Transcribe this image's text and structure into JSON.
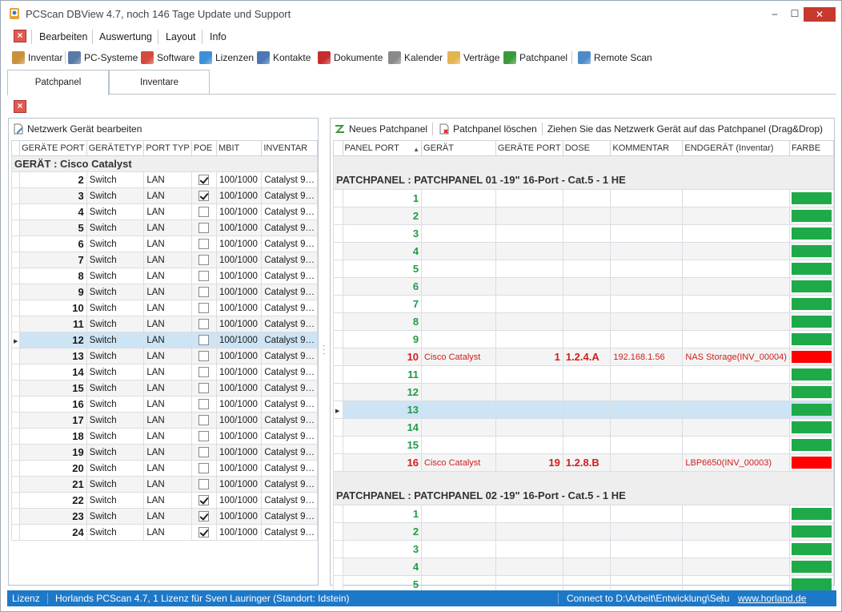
{
  "window": {
    "title": "PCScan DBView 4.7, noch 146 Tage Update und Support",
    "min_glyph": "–",
    "max_glyph": "☐",
    "close_glyph": "✕"
  },
  "menu": [
    {
      "label": "Bearbeiten"
    },
    {
      "label": "Auswertung"
    },
    {
      "label": "Layout"
    },
    {
      "label": "Info"
    }
  ],
  "toolbar": [
    {
      "label": "Inventar",
      "icon": "inventory-icon",
      "color": "#c8913a"
    },
    {
      "label": "PC-Systeme",
      "icon": "computer-icon",
      "color": "#5a7aa6"
    },
    {
      "label": "Software",
      "icon": "software-icon",
      "color": "#d64a3b"
    },
    {
      "label": "Lizenzen",
      "icon": "windows-icon",
      "color": "#3c8fd8"
    },
    {
      "label": "Kontakte",
      "icon": "contacts-icon",
      "color": "#4c77b5"
    },
    {
      "label": "Dokumente",
      "icon": "pdf-icon",
      "color": "#c62e2e"
    },
    {
      "label": "Kalender",
      "icon": "calendar-icon",
      "color": "#8a8a8a"
    },
    {
      "label": "Verträge",
      "icon": "contract-icon",
      "color": "#e2b54e"
    },
    {
      "label": "Patchpanel",
      "icon": "patchpanel-icon",
      "color": "#3a9a3a"
    },
    {
      "label": "Remote Scan",
      "icon": "remote-scan-icon",
      "color": "#4d8ac8"
    }
  ],
  "tabs": [
    {
      "label": "Patchpanel",
      "active": true
    },
    {
      "label": "Inventare",
      "active": false
    }
  ],
  "left": {
    "toolbar_label": "Netzwerk Gerät bearbeiten",
    "columns": [
      "GERÄTE PORT",
      "GERÄTETYP",
      "PORT TYP",
      "POE",
      "MBIT",
      "INVENTAR"
    ],
    "group_label": "GERÄT : Cisco Catalyst",
    "rows": [
      {
        "port": "2",
        "type": "Switch",
        "port_type": "LAN",
        "poe": true,
        "mbit": "100/1000",
        "inventar": "Catalyst 9…"
      },
      {
        "port": "3",
        "type": "Switch",
        "port_type": "LAN",
        "poe": true,
        "mbit": "100/1000",
        "inventar": "Catalyst 9…"
      },
      {
        "port": "4",
        "type": "Switch",
        "port_type": "LAN",
        "poe": false,
        "mbit": "100/1000",
        "inventar": "Catalyst 9…"
      },
      {
        "port": "5",
        "type": "Switch",
        "port_type": "LAN",
        "poe": false,
        "mbit": "100/1000",
        "inventar": "Catalyst 9…"
      },
      {
        "port": "6",
        "type": "Switch",
        "port_type": "LAN",
        "poe": false,
        "mbit": "100/1000",
        "inventar": "Catalyst 9…"
      },
      {
        "port": "7",
        "type": "Switch",
        "port_type": "LAN",
        "poe": false,
        "mbit": "100/1000",
        "inventar": "Catalyst 9…"
      },
      {
        "port": "8",
        "type": "Switch",
        "port_type": "LAN",
        "poe": false,
        "mbit": "100/1000",
        "inventar": "Catalyst 9…"
      },
      {
        "port": "9",
        "type": "Switch",
        "port_type": "LAN",
        "poe": false,
        "mbit": "100/1000",
        "inventar": "Catalyst 9…"
      },
      {
        "port": "10",
        "type": "Switch",
        "port_type": "LAN",
        "poe": false,
        "mbit": "100/1000",
        "inventar": "Catalyst 9…"
      },
      {
        "port": "11",
        "type": "Switch",
        "port_type": "LAN",
        "poe": false,
        "mbit": "100/1000",
        "inventar": "Catalyst 9…"
      },
      {
        "port": "12",
        "type": "Switch",
        "port_type": "LAN",
        "poe": false,
        "mbit": "100/1000",
        "inventar": "Catalyst 9…",
        "selected": true
      },
      {
        "port": "13",
        "type": "Switch",
        "port_type": "LAN",
        "poe": false,
        "mbit": "100/1000",
        "inventar": "Catalyst 9…"
      },
      {
        "port": "14",
        "type": "Switch",
        "port_type": "LAN",
        "poe": false,
        "mbit": "100/1000",
        "inventar": "Catalyst 9…"
      },
      {
        "port": "15",
        "type": "Switch",
        "port_type": "LAN",
        "poe": false,
        "mbit": "100/1000",
        "inventar": "Catalyst 9…"
      },
      {
        "port": "16",
        "type": "Switch",
        "port_type": "LAN",
        "poe": false,
        "mbit": "100/1000",
        "inventar": "Catalyst 9…"
      },
      {
        "port": "17",
        "type": "Switch",
        "port_type": "LAN",
        "poe": false,
        "mbit": "100/1000",
        "inventar": "Catalyst 9…"
      },
      {
        "port": "18",
        "type": "Switch",
        "port_type": "LAN",
        "poe": false,
        "mbit": "100/1000",
        "inventar": "Catalyst 9…"
      },
      {
        "port": "19",
        "type": "Switch",
        "port_type": "LAN",
        "poe": false,
        "mbit": "100/1000",
        "inventar": "Catalyst 9…"
      },
      {
        "port": "20",
        "type": "Switch",
        "port_type": "LAN",
        "poe": false,
        "mbit": "100/1000",
        "inventar": "Catalyst 9…"
      },
      {
        "port": "21",
        "type": "Switch",
        "port_type": "LAN",
        "poe": false,
        "mbit": "100/1000",
        "inventar": "Catalyst 9…"
      },
      {
        "port": "22",
        "type": "Switch",
        "port_type": "LAN",
        "poe": true,
        "mbit": "100/1000",
        "inventar": "Catalyst 9…"
      },
      {
        "port": "23",
        "type": "Switch",
        "port_type": "LAN",
        "poe": true,
        "mbit": "100/1000",
        "inventar": "Catalyst 9…"
      },
      {
        "port": "24",
        "type": "Switch",
        "port_type": "LAN",
        "poe": true,
        "mbit": "100/1000",
        "inventar": "Catalyst 9…"
      }
    ]
  },
  "right": {
    "toolbar": {
      "new_label": "Neues Patchpanel",
      "delete_label": "Patchpanel löschen",
      "hint": "Ziehen Sie das Netzwerk Gerät auf das Patchpanel (Drag&Drop)"
    },
    "columns": [
      "PANEL PORT",
      "GERÄT",
      "GERÄTE PORT",
      "DOSE",
      "KOMMENTAR",
      "ENDGERÄT (Inventar)",
      "FARBE"
    ],
    "sort_glyph": "▲",
    "colors": {
      "free": "#1faa4a",
      "used": "#ff0000"
    },
    "panels": [
      {
        "label": "PATCHPANEL : PATCHPANEL 01 -19\" 16-Port - Cat.5 - 1 HE",
        "rows": [
          {
            "port": "1",
            "device": "",
            "dport": "",
            "dose": "",
            "comment": "",
            "end": "",
            "color": "free"
          },
          {
            "port": "2",
            "device": "",
            "dport": "",
            "dose": "",
            "comment": "",
            "end": "",
            "color": "free"
          },
          {
            "port": "3",
            "device": "",
            "dport": "",
            "dose": "",
            "comment": "",
            "end": "",
            "color": "free"
          },
          {
            "port": "4",
            "device": "",
            "dport": "",
            "dose": "",
            "comment": "",
            "end": "",
            "color": "free"
          },
          {
            "port": "5",
            "device": "",
            "dport": "",
            "dose": "",
            "comment": "",
            "end": "",
            "color": "free"
          },
          {
            "port": "6",
            "device": "",
            "dport": "",
            "dose": "",
            "comment": "",
            "end": "",
            "color": "free"
          },
          {
            "port": "7",
            "device": "",
            "dport": "",
            "dose": "",
            "comment": "",
            "end": "",
            "color": "free"
          },
          {
            "port": "8",
            "device": "",
            "dport": "",
            "dose": "",
            "comment": "",
            "end": "",
            "color": "free"
          },
          {
            "port": "9",
            "device": "",
            "dport": "",
            "dose": "",
            "comment": "",
            "end": "",
            "color": "free"
          },
          {
            "port": "10",
            "device": "Cisco Catalyst",
            "dport": "1",
            "dose": "1.2.4.A",
            "comment": "192.168.1.56",
            "end": "NAS Storage(INV_00004)",
            "color": "used"
          },
          {
            "port": "11",
            "device": "",
            "dport": "",
            "dose": "",
            "comment": "",
            "end": "",
            "color": "free"
          },
          {
            "port": "12",
            "device": "",
            "dport": "",
            "dose": "",
            "comment": "",
            "end": "",
            "color": "free"
          },
          {
            "port": "13",
            "device": "",
            "dport": "",
            "dose": "",
            "comment": "",
            "end": "",
            "color": "free",
            "selected": true
          },
          {
            "port": "14",
            "device": "",
            "dport": "",
            "dose": "",
            "comment": "",
            "end": "",
            "color": "free"
          },
          {
            "port": "15",
            "device": "",
            "dport": "",
            "dose": "",
            "comment": "",
            "end": "",
            "color": "free"
          },
          {
            "port": "16",
            "device": "Cisco Catalyst",
            "dport": "19",
            "dose": "1.2.8.B",
            "comment": "",
            "end": "LBP6650(INV_00003)",
            "color": "used"
          }
        ]
      },
      {
        "label": "PATCHPANEL : PATCHPANEL 02 -19\" 16-Port - Cat.5 - 1 HE",
        "rows": [
          {
            "port": "1",
            "device": "",
            "dport": "",
            "dose": "",
            "comment": "",
            "end": "",
            "color": "free"
          },
          {
            "port": "2",
            "device": "",
            "dport": "",
            "dose": "",
            "comment": "",
            "end": "",
            "color": "free"
          },
          {
            "port": "3",
            "device": "",
            "dport": "",
            "dose": "",
            "comment": "",
            "end": "",
            "color": "free"
          },
          {
            "port": "4",
            "device": "",
            "dport": "",
            "dose": "",
            "comment": "",
            "end": "",
            "color": "free"
          },
          {
            "port": "5",
            "device": "",
            "dport": "",
            "dose": "",
            "comment": "",
            "end": "",
            "color": "free"
          }
        ]
      }
    ]
  },
  "status": {
    "license": "Lizenz",
    "info": "Horlands PCScan 4.7, 1 Lizenz für Sven Lauringer (Standort: Idstein)",
    "connect": "Connect to D:\\Arbeit\\Entwicklung\\Setu",
    "url": "www.horland.de"
  }
}
